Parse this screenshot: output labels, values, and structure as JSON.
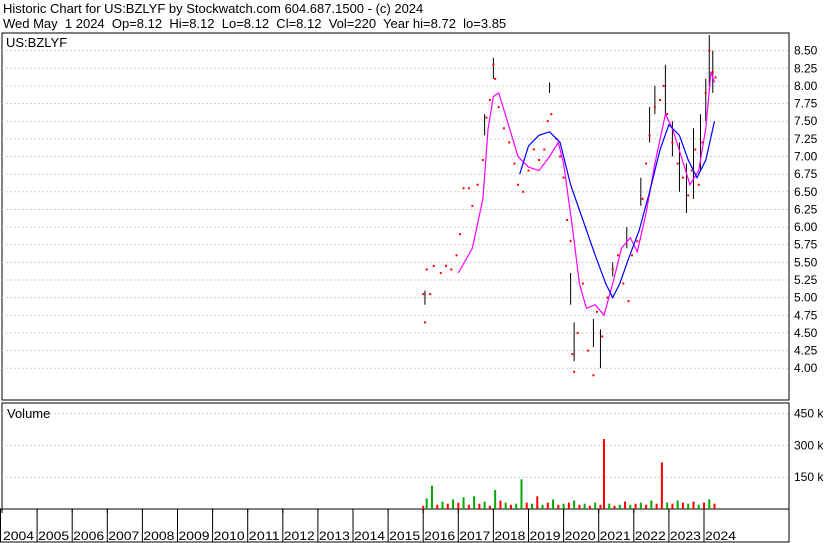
{
  "header": {
    "line1": "Historic Chart for US:BZLYF by Stockwatch.com 604.687.1500 - (c) 2024",
    "line2": "Wed May  1 2024  Op=8.12  Hi=8.12  Lo=8.12  Cl=8.12  Vol=220  Year hi=8.72  lo=3.85"
  },
  "colors": {
    "background": "#ffffff",
    "grid": "#cfcfcf",
    "hilo_bars": "#000000",
    "close_dots": "#ff0000",
    "ma_short": "#ff00ff",
    "ma_long": "#0000ff",
    "volume_up": "#00aa00",
    "volume_down": "#ff0000"
  },
  "chart_data": [
    {
      "type": "line",
      "name": "price-panel",
      "label": "US:BZLYF",
      "x_unit": "year",
      "xlim": [
        2004,
        2024.35
      ],
      "ylim": [
        3.55,
        8.75
      ],
      "y_ticks": [
        "8.50",
        "8.25",
        "8.00",
        "7.75",
        "7.50",
        "7.25",
        "7.00",
        "6.75",
        "6.50",
        "6.25",
        "6.00",
        "5.75",
        "5.50",
        "5.25",
        "5.00",
        "4.75",
        "4.50",
        "4.25",
        "4.00"
      ],
      "y_tick_values": [
        8.5,
        8.25,
        8.0,
        7.75,
        7.5,
        7.25,
        7.0,
        6.75,
        6.5,
        6.25,
        6.0,
        5.75,
        5.5,
        5.25,
        5.0,
        4.75,
        4.5,
        4.25,
        4.0
      ],
      "grid": true,
      "series": [
        {
          "style": "dots",
          "points": [
            [
              2016.0,
              5.05
            ],
            [
              2016.05,
              4.65
            ],
            [
              2016.1,
              5.4
            ],
            [
              2016.2,
              5.05
            ],
            [
              2016.3,
              5.45
            ],
            [
              2016.5,
              5.35
            ],
            [
              2016.65,
              5.45
            ],
            [
              2016.8,
              5.4
            ],
            [
              2016.95,
              5.6
            ],
            [
              2017.05,
              5.9
            ],
            [
              2017.15,
              6.55
            ],
            [
              2017.3,
              6.55
            ],
            [
              2017.4,
              6.3
            ],
            [
              2017.55,
              6.6
            ],
            [
              2017.7,
              6.95
            ],
            [
              2017.8,
              7.55
            ],
            [
              2017.9,
              7.8
            ],
            [
              2018.0,
              8.3
            ],
            [
              2018.05,
              8.1
            ],
            [
              2018.15,
              7.7
            ],
            [
              2018.3,
              7.4
            ],
            [
              2018.45,
              7.2
            ],
            [
              2018.6,
              6.9
            ],
            [
              2018.7,
              6.6
            ],
            [
              2018.85,
              6.5
            ],
            [
              2019.0,
              6.8
            ],
            [
              2019.15,
              7.1
            ],
            [
              2019.3,
              6.95
            ],
            [
              2019.45,
              7.1
            ],
            [
              2019.55,
              7.5
            ],
            [
              2019.65,
              7.6
            ],
            [
              2019.8,
              7.25
            ],
            [
              2019.9,
              7.0
            ],
            [
              2020.0,
              6.7
            ],
            [
              2020.1,
              6.1
            ],
            [
              2020.2,
              5.8
            ],
            [
              2020.25,
              4.2
            ],
            [
              2020.3,
              3.95
            ],
            [
              2020.4,
              4.5
            ],
            [
              2020.55,
              5.2
            ],
            [
              2020.7,
              4.25
            ],
            [
              2020.85,
              3.9
            ],
            [
              2020.95,
              4.8
            ],
            [
              2021.1,
              4.45
            ],
            [
              2021.25,
              5.0
            ],
            [
              2021.4,
              5.4
            ],
            [
              2021.55,
              5.6
            ],
            [
              2021.7,
              5.2
            ],
            [
              2021.85,
              4.95
            ],
            [
              2021.95,
              5.6
            ],
            [
              2022.1,
              5.8
            ],
            [
              2022.25,
              6.4
            ],
            [
              2022.35,
              6.9
            ],
            [
              2022.45,
              7.3
            ],
            [
              2022.6,
              7.7
            ],
            [
              2022.75,
              7.8
            ],
            [
              2022.85,
              8.0
            ],
            [
              2022.95,
              7.6
            ],
            [
              2023.1,
              7.2
            ],
            [
              2023.25,
              6.9
            ],
            [
              2023.4,
              6.7
            ],
            [
              2023.55,
              6.45
            ],
            [
              2023.65,
              6.8
            ],
            [
              2023.75,
              7.1
            ],
            [
              2023.85,
              6.6
            ],
            [
              2023.95,
              7.2
            ],
            [
              2024.05,
              7.9
            ],
            [
              2024.15,
              8.5
            ],
            [
              2024.25,
              8.2
            ],
            [
              2024.33,
              8.12
            ]
          ]
        },
        {
          "style": "hilo",
          "bars": [
            [
              2016.05,
              4.9,
              5.1
            ],
            [
              2017.75,
              7.3,
              7.6
            ],
            [
              2018.0,
              8.1,
              8.4
            ],
            [
              2019.6,
              7.9,
              8.05
            ],
            [
              2020.2,
              4.9,
              5.35
            ],
            [
              2020.3,
              4.1,
              4.65
            ],
            [
              2020.85,
              4.3,
              4.7
            ],
            [
              2021.05,
              4.0,
              4.55
            ],
            [
              2021.4,
              5.3,
              5.5
            ],
            [
              2021.8,
              5.7,
              6.0
            ],
            [
              2022.2,
              6.3,
              6.7
            ],
            [
              2022.45,
              7.2,
              7.7
            ],
            [
              2022.6,
              7.6,
              8.0
            ],
            [
              2022.9,
              7.6,
              8.3
            ],
            [
              2023.1,
              7.0,
              7.5
            ],
            [
              2023.3,
              6.5,
              7.2
            ],
            [
              2023.5,
              6.2,
              6.9
            ],
            [
              2023.7,
              6.4,
              7.4
            ],
            [
              2023.9,
              6.8,
              7.6
            ],
            [
              2024.05,
              7.5,
              8.1
            ],
            [
              2024.15,
              8.0,
              8.72
            ],
            [
              2024.25,
              7.9,
              8.5
            ]
          ]
        },
        {
          "style": "line",
          "color_key": "ma_short",
          "points": [
            [
              2017.0,
              5.35
            ],
            [
              2017.4,
              5.7
            ],
            [
              2017.7,
              6.4
            ],
            [
              2017.85,
              7.4
            ],
            [
              2018.0,
              7.85
            ],
            [
              2018.15,
              7.9
            ],
            [
              2018.4,
              7.5
            ],
            [
              2018.7,
              7.0
            ],
            [
              2019.0,
              6.85
            ],
            [
              2019.3,
              6.8
            ],
            [
              2019.6,
              7.0
            ],
            [
              2019.85,
              7.2
            ],
            [
              2020.0,
              6.9
            ],
            [
              2020.25,
              6.0
            ],
            [
              2020.45,
              5.2
            ],
            [
              2020.65,
              4.85
            ],
            [
              2020.9,
              4.9
            ],
            [
              2021.15,
              4.75
            ],
            [
              2021.4,
              5.2
            ],
            [
              2021.65,
              5.7
            ],
            [
              2021.9,
              5.85
            ],
            [
              2022.1,
              5.65
            ],
            [
              2022.35,
              6.2
            ],
            [
              2022.6,
              6.9
            ],
            [
              2022.9,
              7.6
            ],
            [
              2023.1,
              7.4
            ],
            [
              2023.35,
              7.0
            ],
            [
              2023.6,
              6.6
            ],
            [
              2023.85,
              6.8
            ],
            [
              2024.05,
              7.4
            ],
            [
              2024.2,
              8.2
            ],
            [
              2024.3,
              8.05
            ]
          ]
        },
        {
          "style": "line",
          "color_key": "ma_long",
          "points": [
            [
              2018.75,
              6.75
            ],
            [
              2019.0,
              7.15
            ],
            [
              2019.3,
              7.3
            ],
            [
              2019.6,
              7.35
            ],
            [
              2019.9,
              7.2
            ],
            [
              2020.2,
              6.6
            ],
            [
              2020.55,
              6.1
            ],
            [
              2020.9,
              5.6
            ],
            [
              2021.2,
              5.2
            ],
            [
              2021.4,
              5.0
            ],
            [
              2021.6,
              5.2
            ],
            [
              2021.85,
              5.55
            ],
            [
              2022.15,
              5.95
            ],
            [
              2022.45,
              6.5
            ],
            [
              2022.75,
              7.1
            ],
            [
              2023.0,
              7.45
            ],
            [
              2023.3,
              7.3
            ],
            [
              2023.55,
              6.95
            ],
            [
              2023.8,
              6.7
            ],
            [
              2024.05,
              6.95
            ],
            [
              2024.3,
              7.5
            ]
          ]
        }
      ]
    },
    {
      "type": "bar",
      "name": "volume-panel",
      "title": "Volume",
      "x_unit": "year",
      "xlim": [
        2004,
        2024.35
      ],
      "ylim": [
        0,
        500000
      ],
      "y_ticks": [
        "450 k",
        "300 k",
        "150 k"
      ],
      "y_tick_values": [
        450000,
        300000,
        150000
      ],
      "x_ticks": [
        "2004",
        "2005",
        "2006",
        "2007",
        "2008",
        "2009",
        "2010",
        "2011",
        "2012",
        "2013",
        "2014",
        "2015",
        "2016",
        "2017",
        "2018",
        "2019",
        "2020",
        "2021",
        "2022",
        "2023",
        "2024"
      ],
      "x_tick_values": [
        2004,
        2005,
        2006,
        2007,
        2008,
        2009,
        2010,
        2011,
        2012,
        2013,
        2014,
        2015,
        2016,
        2017,
        2018,
        2019,
        2020,
        2021,
        2022,
        2023,
        2024
      ],
      "bars": [
        [
          2016.0,
          15000,
          "down"
        ],
        [
          2016.1,
          50000,
          "up"
        ],
        [
          2016.25,
          110000,
          "up"
        ],
        [
          2016.4,
          20000,
          "down"
        ],
        [
          2016.55,
          35000,
          "up"
        ],
        [
          2016.7,
          25000,
          "down"
        ],
        [
          2016.85,
          45000,
          "up"
        ],
        [
          2017.0,
          30000,
          "down"
        ],
        [
          2017.15,
          55000,
          "up"
        ],
        [
          2017.3,
          20000,
          "down"
        ],
        [
          2017.45,
          60000,
          "up"
        ],
        [
          2017.6,
          25000,
          "down"
        ],
        [
          2017.75,
          35000,
          "up"
        ],
        [
          2017.9,
          15000,
          "down"
        ],
        [
          2018.05,
          90000,
          "up"
        ],
        [
          2018.2,
          40000,
          "down"
        ],
        [
          2018.35,
          30000,
          "up"
        ],
        [
          2018.5,
          20000,
          "down"
        ],
        [
          2018.65,
          25000,
          "up"
        ],
        [
          2018.8,
          140000,
          "up"
        ],
        [
          2018.95,
          30000,
          "down"
        ],
        [
          2019.1,
          25000,
          "up"
        ],
        [
          2019.25,
          60000,
          "down"
        ],
        [
          2019.4,
          20000,
          "up"
        ],
        [
          2019.55,
          30000,
          "down"
        ],
        [
          2019.7,
          45000,
          "up"
        ],
        [
          2019.85,
          20000,
          "down"
        ],
        [
          2020.0,
          25000,
          "up"
        ],
        [
          2020.15,
          30000,
          "down"
        ],
        [
          2020.3,
          40000,
          "up"
        ],
        [
          2020.45,
          20000,
          "down"
        ],
        [
          2020.6,
          25000,
          "up"
        ],
        [
          2020.75,
          15000,
          "down"
        ],
        [
          2020.9,
          30000,
          "up"
        ],
        [
          2021.05,
          20000,
          "down"
        ],
        [
          2021.15,
          330000,
          "down"
        ],
        [
          2021.3,
          25000,
          "up"
        ],
        [
          2021.45,
          15000,
          "down"
        ],
        [
          2021.6,
          20000,
          "up"
        ],
        [
          2021.75,
          35000,
          "down"
        ],
        [
          2021.9,
          20000,
          "up"
        ],
        [
          2022.05,
          25000,
          "down"
        ],
        [
          2022.2,
          30000,
          "up"
        ],
        [
          2022.35,
          20000,
          "down"
        ],
        [
          2022.5,
          40000,
          "up"
        ],
        [
          2022.65,
          25000,
          "down"
        ],
        [
          2022.8,
          220000,
          "down"
        ],
        [
          2022.95,
          30000,
          "up"
        ],
        [
          2023.1,
          25000,
          "down"
        ],
        [
          2023.25,
          40000,
          "up"
        ],
        [
          2023.4,
          30000,
          "down"
        ],
        [
          2023.55,
          25000,
          "up"
        ],
        [
          2023.7,
          35000,
          "down"
        ],
        [
          2023.85,
          20000,
          "up"
        ],
        [
          2024.0,
          30000,
          "down"
        ],
        [
          2024.15,
          45000,
          "up"
        ],
        [
          2024.3,
          25000,
          "down"
        ]
      ]
    }
  ]
}
